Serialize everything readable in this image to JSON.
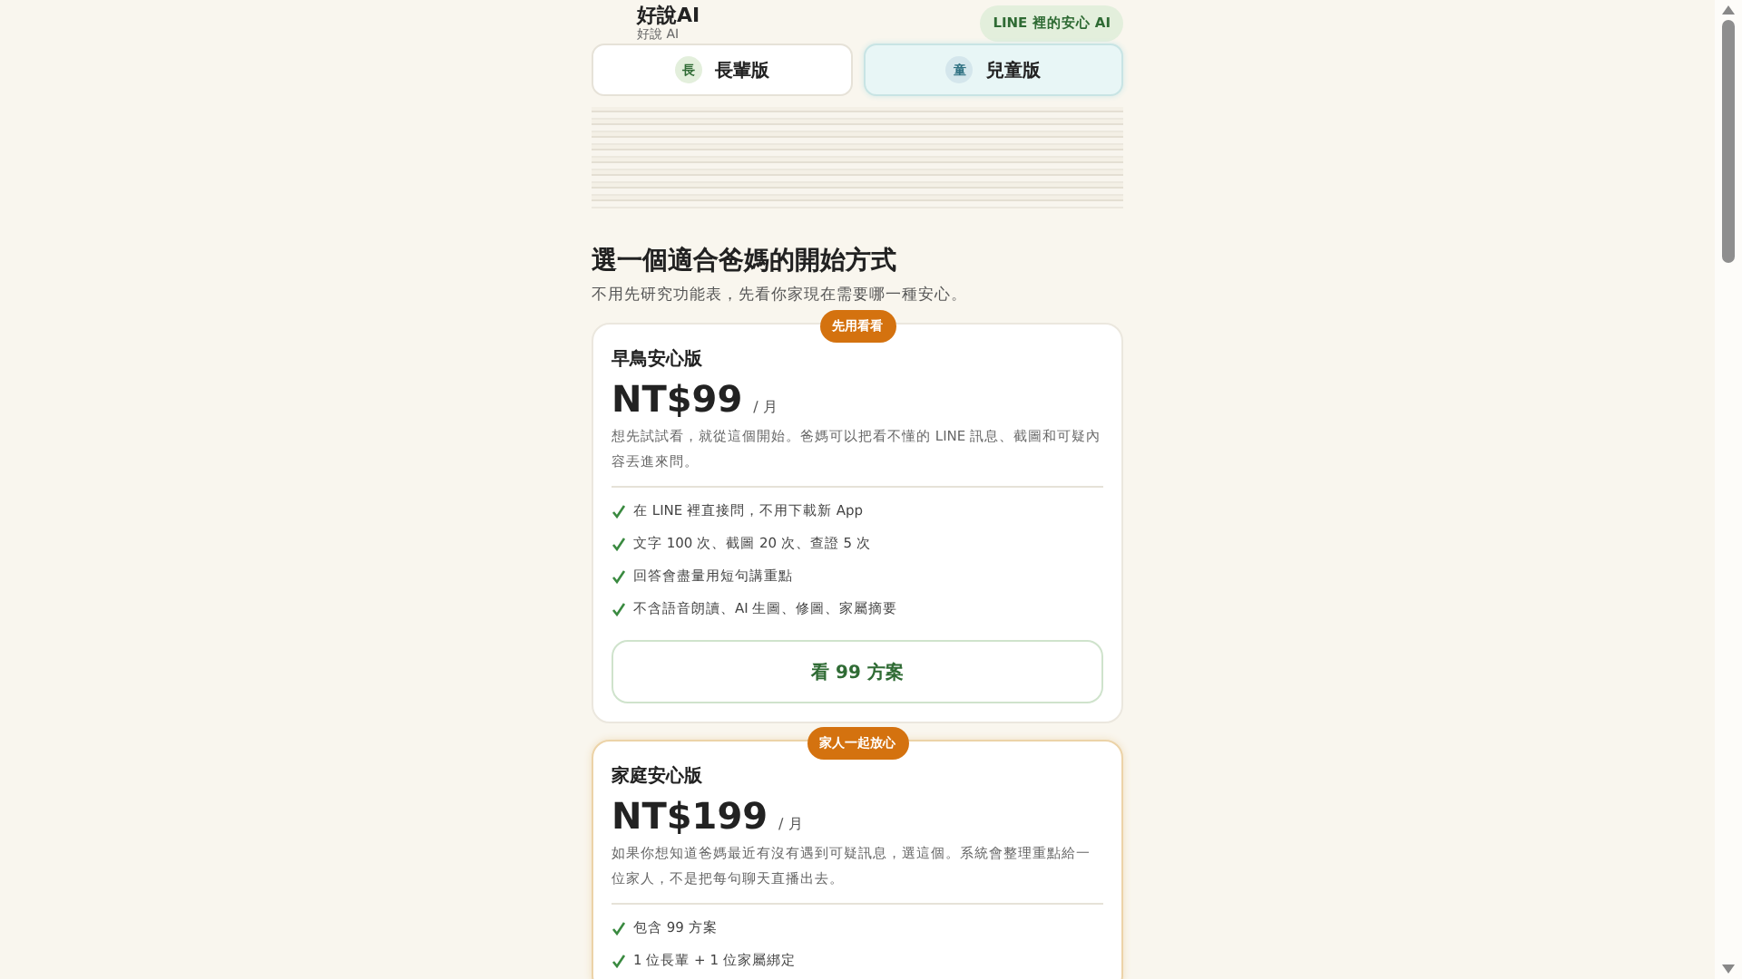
{
  "header": {
    "brand": "好說AI",
    "subtitle": "好說 AI",
    "badge": "LINE 裡的安心 AI"
  },
  "tabs": [
    {
      "icon": "長",
      "label": "長輩版",
      "selected": false
    },
    {
      "icon": "童",
      "label": "兒童版",
      "selected": true
    }
  ],
  "section": {
    "title": "選一個適合爸媽的開始方式",
    "subtitle": "不用先研究功能表，先看你家現在需要哪一種安心。"
  },
  "plans": [
    {
      "badge": "先用看看",
      "name": "早鳥安心版",
      "price": "NT$99",
      "period": "/ 月",
      "description": "想先試試看，就從這個開始。爸媽可以把看不懂的 LINE 訊息、截圖和可疑內容丟進來問。",
      "features": [
        "在 LINE 裡直接問，不用下載新 App",
        "文字 100 次、截圖 20 次、查證 5 次",
        "回答會盡量用短句講重點",
        "不含語音朗讀、AI 生圖、修圖、家屬摘要"
      ],
      "button": "看 99 方案",
      "highlighted": false
    },
    {
      "badge": "家人一起放心",
      "name": "家庭安心版",
      "price": "NT$199",
      "period": "/ 月",
      "description": "如果你想知道爸媽最近有沒有遇到可疑訊息，選這個。系統會整理重點給一位家人，不是把每句聊天直播出去。",
      "features": [
        "包含 99 方案",
        "1 位長輩 + 1 位家屬綁定"
      ],
      "highlighted": true
    }
  ]
}
